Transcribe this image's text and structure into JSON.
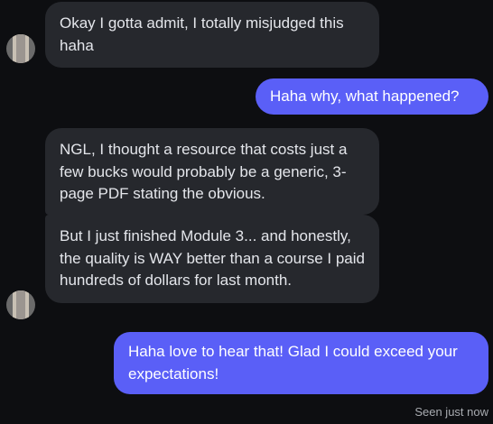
{
  "messages": [
    {
      "direction": "received",
      "text": "Okay I gotta admit, I totally misjudged this haha"
    },
    {
      "direction": "sent",
      "text": "Haha why, what happened?"
    },
    {
      "direction": "received",
      "text": "NGL, I thought a resource that costs just a few bucks would probably be a generic, 3-page PDF stating the obvious."
    },
    {
      "direction": "received",
      "text": "But I just finished Module 3... and honestly, the quality is WAY better than a course I paid hundreds of dollars for last month."
    },
    {
      "direction": "sent",
      "text": "Haha love to hear that! Glad I could exceed your expectations!"
    }
  ],
  "status": {
    "seen": "Seen just now"
  },
  "colors": {
    "background": "#0d0e11",
    "received_bubble": "#26282d",
    "sent_bubble": "#5a5ff7"
  },
  "icons": {
    "avatar": "contact-avatar"
  }
}
